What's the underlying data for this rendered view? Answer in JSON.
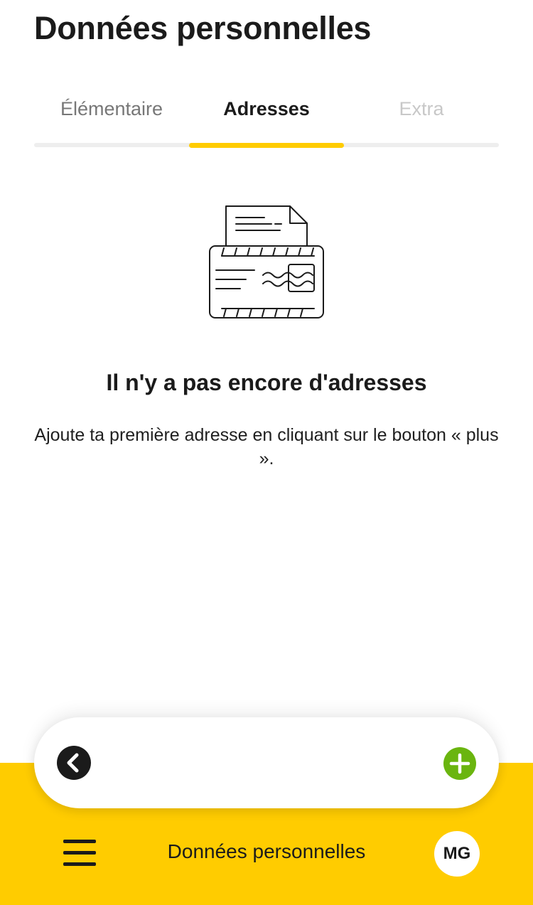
{
  "header": {
    "title": "Données personnelles"
  },
  "tabs": [
    {
      "label": "Élémentaire",
      "state": "default"
    },
    {
      "label": "Adresses",
      "state": "active"
    },
    {
      "label": "Extra",
      "state": "disabled"
    }
  ],
  "empty_state": {
    "icon": "postcard-envelope-icon",
    "title": "Il n'y a pas encore d'adresses",
    "description": "Ajoute ta première adresse en cliquant sur le bouton « plus »."
  },
  "action_bar": {
    "back_icon": "chevron-left-icon",
    "add_icon": "plus-icon"
  },
  "bottom_nav": {
    "menu_icon": "hamburger-menu-icon",
    "title": "Données personnelles",
    "avatar_initials": "MG"
  },
  "colors": {
    "accent": "#ffcc00",
    "add_button": "#6ab50f",
    "text": "#1b1b1b",
    "tab_inactive": "#777777",
    "tab_disabled": "#c8c8c8"
  }
}
